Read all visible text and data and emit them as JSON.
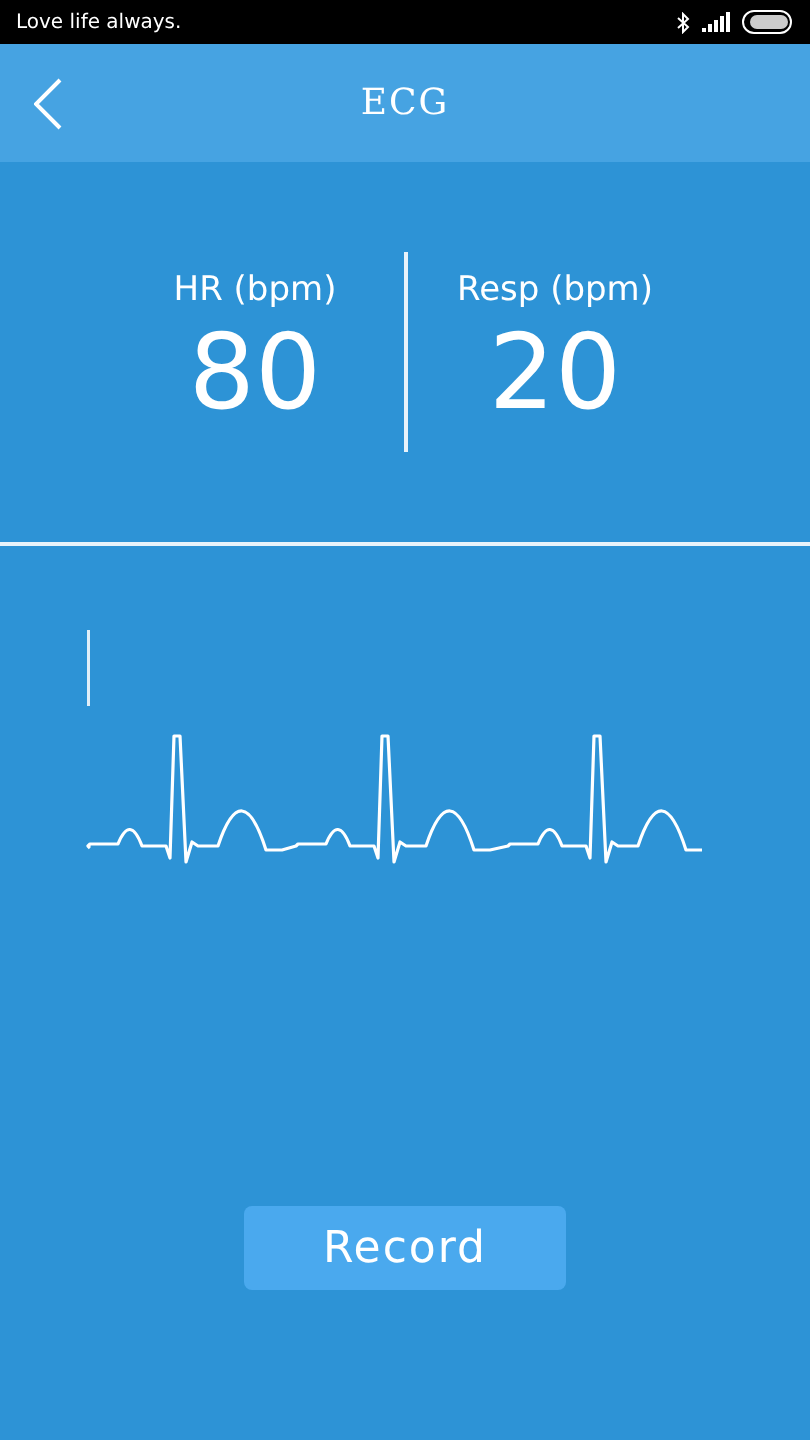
{
  "status_bar": {
    "carrier": "Love life always."
  },
  "header": {
    "title": "ECG"
  },
  "metrics": [
    {
      "label": "HR (bpm)",
      "value": "80"
    },
    {
      "label": "Resp (bpm)",
      "value": "20"
    }
  ],
  "record_button": "Record"
}
